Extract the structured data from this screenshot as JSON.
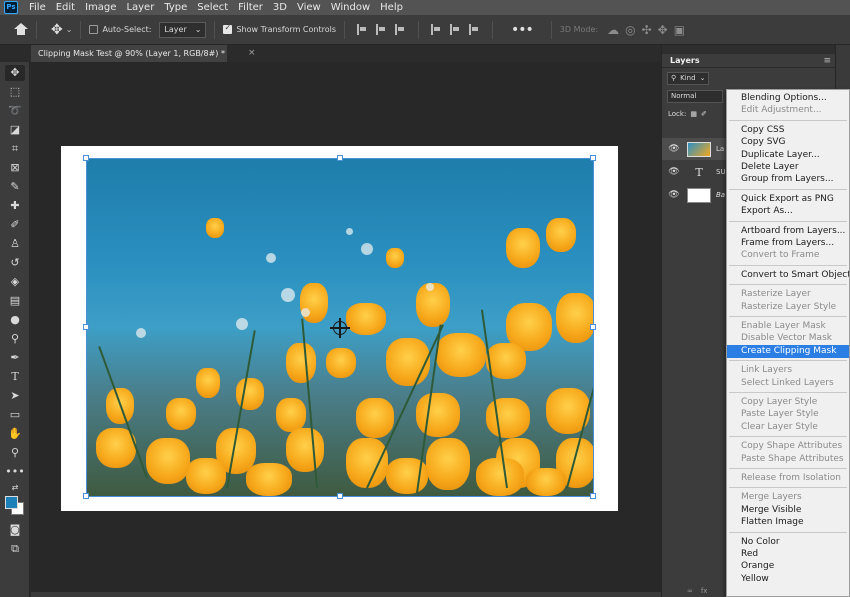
{
  "app": {
    "logo": "Ps"
  },
  "menubar": {
    "items": [
      "File",
      "Edit",
      "Image",
      "Layer",
      "Type",
      "Select",
      "Filter",
      "3D",
      "View",
      "Window",
      "Help"
    ]
  },
  "options": {
    "auto_select_label": "Auto-Select:",
    "auto_select_checked": false,
    "auto_select_target": "Layer",
    "show_transform_label": "Show Transform Controls",
    "show_transform_checked": true,
    "mode_3d_label": "3D Mode:"
  },
  "document": {
    "tab_title": "Clipping Mask Test @ 90% (Layer 1, RGB/8#) *",
    "close": "×"
  },
  "layers_panel": {
    "title": "Layers",
    "filter_kind": "Kind",
    "blend_mode": "Normal",
    "lock_label": "Lock:",
    "layers": [
      {
        "name": "La",
        "type": "image",
        "selected": true
      },
      {
        "name": "SU",
        "type": "text",
        "selected": false
      },
      {
        "name": "Ba",
        "type": "background",
        "selected": false
      }
    ],
    "bottom_icons": [
      "link-icon",
      "fx-icon"
    ],
    "bottom_labels": [
      "∞",
      "fx"
    ]
  },
  "context_menu": {
    "groups": [
      [
        {
          "label": "Blending Options...",
          "enabled": true
        },
        {
          "label": "Edit Adjustment...",
          "enabled": false
        }
      ],
      [
        {
          "label": "Copy CSS",
          "enabled": true
        },
        {
          "label": "Copy SVG",
          "enabled": true
        },
        {
          "label": "Duplicate Layer...",
          "enabled": true
        },
        {
          "label": "Delete Layer",
          "enabled": true
        },
        {
          "label": "Group from Layers...",
          "enabled": true
        }
      ],
      [
        {
          "label": "Quick Export as PNG",
          "enabled": true
        },
        {
          "label": "Export As...",
          "enabled": true
        }
      ],
      [
        {
          "label": "Artboard from Layers...",
          "enabled": true
        },
        {
          "label": "Frame from Layers...",
          "enabled": true
        },
        {
          "label": "Convert to Frame",
          "enabled": false
        }
      ],
      [
        {
          "label": "Convert to Smart Object",
          "enabled": true
        }
      ],
      [
        {
          "label": "Rasterize Layer",
          "enabled": false
        },
        {
          "label": "Rasterize Layer Style",
          "enabled": false
        }
      ],
      [
        {
          "label": "Enable Layer Mask",
          "enabled": false
        },
        {
          "label": "Disable Vector Mask",
          "enabled": false
        },
        {
          "label": "Create Clipping Mask",
          "enabled": true,
          "highlighted": true
        }
      ],
      [
        {
          "label": "Link Layers",
          "enabled": false
        },
        {
          "label": "Select Linked Layers",
          "enabled": false
        }
      ],
      [
        {
          "label": "Copy Layer Style",
          "enabled": false
        },
        {
          "label": "Paste Layer Style",
          "enabled": false
        },
        {
          "label": "Clear Layer Style",
          "enabled": false
        }
      ],
      [
        {
          "label": "Copy Shape Attributes",
          "enabled": false
        },
        {
          "label": "Paste Shape Attributes",
          "enabled": false
        }
      ],
      [
        {
          "label": "Release from Isolation",
          "enabled": false
        }
      ],
      [
        {
          "label": "Merge Layers",
          "enabled": false
        },
        {
          "label": "Merge Visible",
          "enabled": true
        },
        {
          "label": "Flatten Image",
          "enabled": true
        }
      ],
      [
        {
          "label": "No Color",
          "enabled": true
        },
        {
          "label": "Red",
          "enabled": true
        },
        {
          "label": "Orange",
          "enabled": true
        },
        {
          "label": "Yellow",
          "enabled": true
        }
      ]
    ]
  },
  "colors": {
    "foreground": "#1d7fb8",
    "background": "#ffffff",
    "menu_highlight": "#2a7ee4",
    "selection": "#4a8fd8"
  }
}
